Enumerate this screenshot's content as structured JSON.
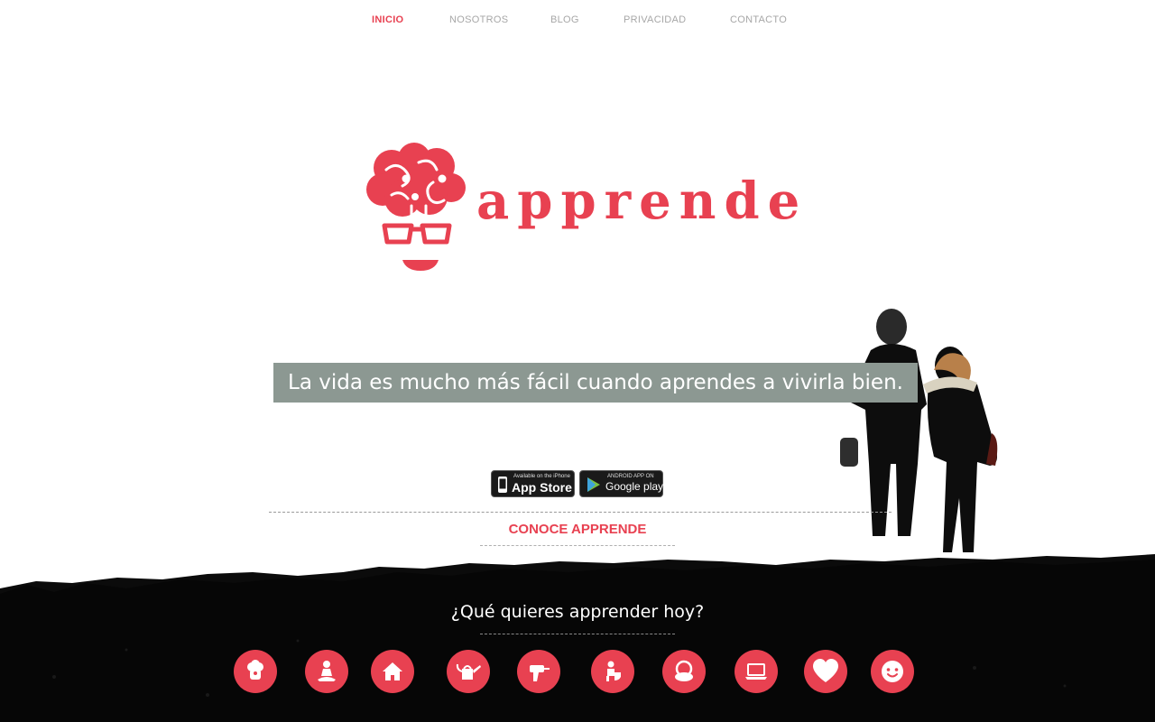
{
  "nav": {
    "items": [
      {
        "label": "INICIO",
        "active": true
      },
      {
        "label": "NOSOTROS",
        "active": false
      },
      {
        "label": "BLOG",
        "active": false
      },
      {
        "label": "PRIVACIDAD",
        "active": false
      },
      {
        "label": "CONTACTO",
        "active": false
      }
    ]
  },
  "brand": {
    "name": "apprende",
    "color": "#e84151"
  },
  "hero": {
    "tagline": "La vida es mucho más fácil cuando aprendes a vivirla bien.",
    "tagline_bg": "#8c9892"
  },
  "stores": {
    "appstore_small": "Available on the iPhone",
    "appstore_big": "App Store",
    "googleplay_small": "ANDROID APP ON",
    "googleplay_big": "Google play"
  },
  "cta": {
    "label": "CONOCE APPRENDE"
  },
  "categories": {
    "question": "¿Qué quieres apprender hoy?",
    "icons": [
      "chef-hat-icon",
      "meditation-icon",
      "home-icon",
      "watering-can-icon",
      "drill-icon",
      "toilet-icon",
      "makeup-compact-icon",
      "laptop-icon",
      "heart-icon",
      "smiley-icon"
    ]
  }
}
